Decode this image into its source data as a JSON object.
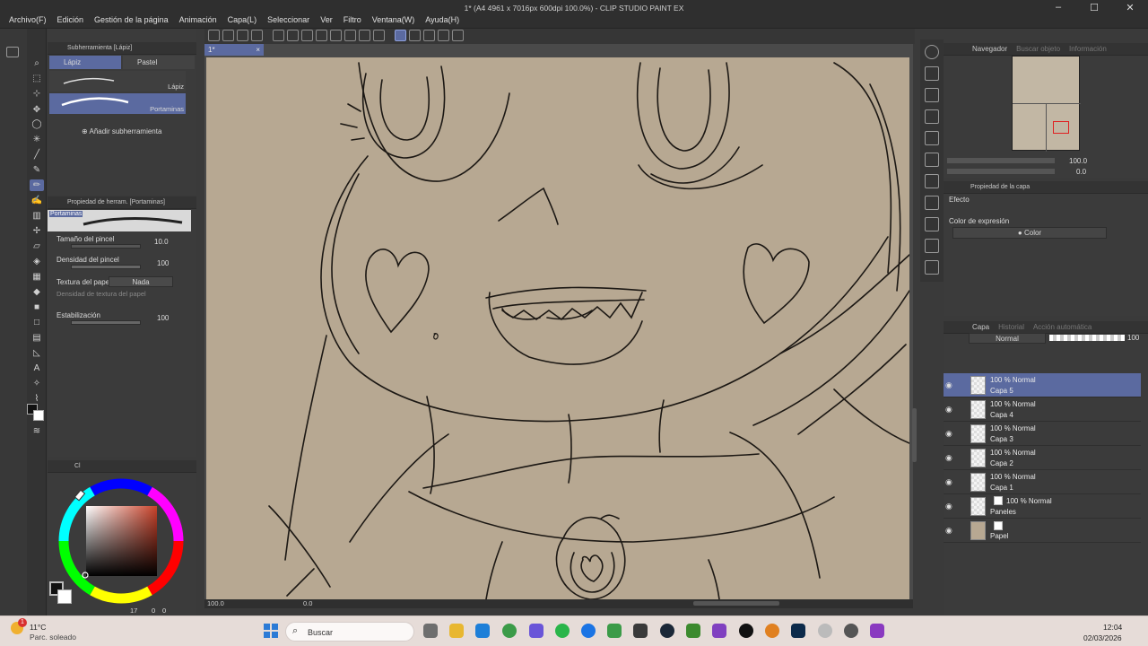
{
  "app": {
    "title": "1* (A4 4961 x 7016px 600dpi 100.0%) - CLIP STUDIO PAINT EX",
    "menu": [
      "Archivo(F)",
      "Edición",
      "Gestión de la página",
      "Animación",
      "Capa(L)",
      "Seleccionar",
      "Ver",
      "Filtro",
      "Ventana(W)",
      "Ayuda(H)"
    ],
    "window_controls": [
      "–",
      "☐",
      "✕"
    ]
  },
  "document_tab": {
    "label": "1*",
    "close": "×"
  },
  "subtool": {
    "header": "Subherramienta [Lápiz]",
    "tabs": [
      "Lápiz",
      "Pastel"
    ],
    "items": [
      "Lápiz",
      "Portaminas"
    ],
    "add_label": "Añadir subherramienta"
  },
  "tool_property": {
    "header": "Propiedad de herram. [Portaminas]",
    "preview_name": "Portaminas",
    "brush_size_label": "Tamaño del pincel",
    "brush_size_value": "10.0",
    "density_label": "Densidad del pincel",
    "density_value": "100",
    "paper_texture_label": "Textura del papel",
    "paper_texture_value": "Nada",
    "texture_density_label": "Densidad de textura del papel",
    "stabilization_label": "Estabilización",
    "stabilization_value": "100"
  },
  "color": {
    "tab_label": "Cl",
    "main_color": "#111111",
    "sub_color": "#ffffff",
    "hue_selected": "#c8422a",
    "bottom_value_1": "17",
    "bottom_value_2": "0",
    "bottom_value_3": "0"
  },
  "status": {
    "zoom": "100.0",
    "angle": "0.0"
  },
  "navigator": {
    "tabs": [
      "Navegador",
      "Buscar objeto",
      "Información"
    ],
    "zoom": "100.0",
    "angle": "0.0"
  },
  "layer_property": {
    "tab_label": "Propiedad de la capa",
    "effect_label": "Efecto",
    "expression_label": "Color de expresión",
    "expression_value": "Color"
  },
  "layers_panel": {
    "tabs": [
      "Capa",
      "Historial",
      "Acción automática"
    ],
    "blend_mode": "Normal",
    "opacity": "100",
    "layers": [
      {
        "mode": "100 % Normal",
        "name": "Capa 5",
        "selected": true
      },
      {
        "mode": "100 % Normal",
        "name": "Capa 4",
        "selected": false
      },
      {
        "mode": "100 % Normal",
        "name": "Capa 3",
        "selected": false
      },
      {
        "mode": "100 % Normal",
        "name": "Capa 2",
        "selected": false
      },
      {
        "mode": "100 % Normal",
        "name": "Capa 1",
        "selected": false
      },
      {
        "mode": "100 % Normal",
        "name": "Paneles",
        "selected": false
      },
      {
        "mode": "",
        "name": "Papel",
        "selected": false
      }
    ]
  },
  "taskbar": {
    "weather_temp": "11°C",
    "weather_desc": "Parc. soleado",
    "weather_badge": "1",
    "search_placeholder": "Buscar",
    "time": "12:04",
    "date": "02/03/2026"
  },
  "canvas_colors": {
    "paper": "#b7a892",
    "ink": "#1c1814"
  }
}
